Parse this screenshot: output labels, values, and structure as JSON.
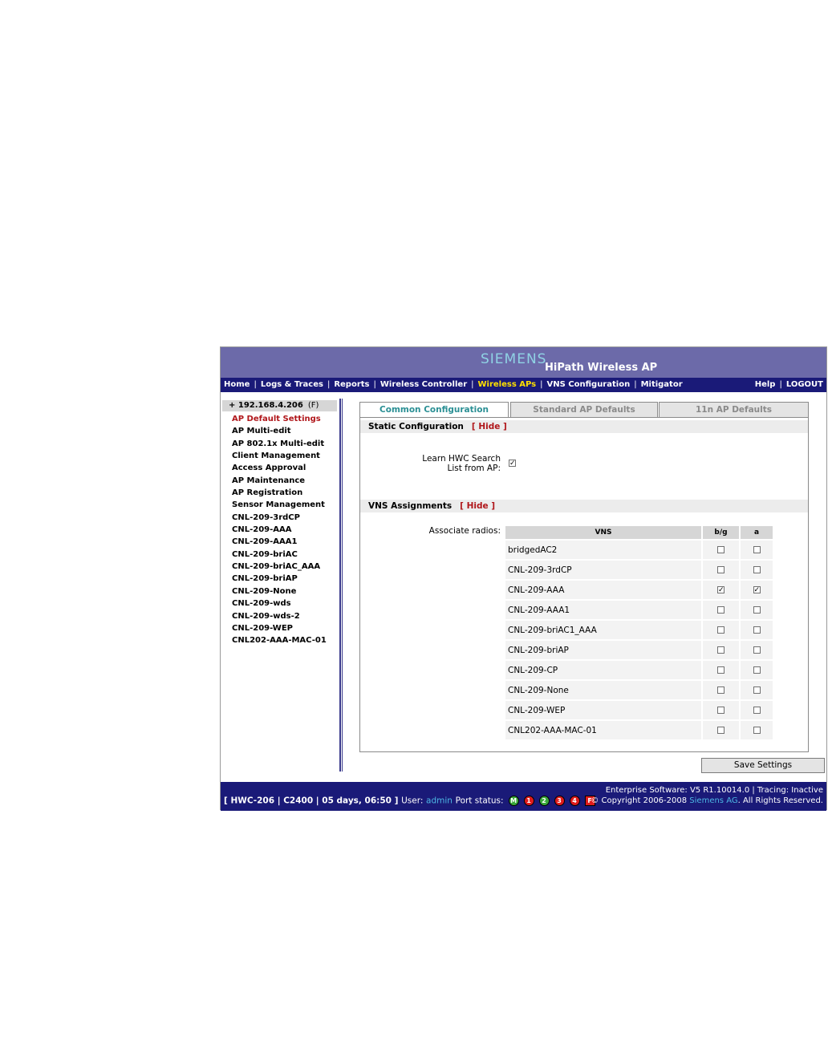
{
  "header": {
    "brand": "SIEMENS",
    "product": "HiPath Wireless AP"
  },
  "nav": {
    "items": [
      "Home",
      "Logs & Traces",
      "Reports",
      "Wireless Controller",
      "Wireless APs",
      "VNS Configuration",
      "Mitigator"
    ],
    "active": "Wireless APs",
    "help": "Help",
    "logout": "LOGOUT"
  },
  "sidebar": {
    "root": "+ 192.168.4.206",
    "root_flag": "(F)",
    "items": [
      "AP Default Settings",
      "AP Multi-edit",
      "AP 802.1x Multi-edit",
      "Client Management",
      "Access Approval",
      "AP Maintenance",
      "AP Registration",
      "Sensor Management",
      "CNL-209-3rdCP",
      "CNL-209-AAA",
      "CNL-209-AAA1",
      "CNL-209-briAC",
      "CNL-209-briAC_AAA",
      "CNL-209-briAP",
      "CNL-209-None",
      "CNL-209-wds",
      "CNL-209-wds-2",
      "CNL-209-WEP",
      "CNL202-AAA-MAC-01"
    ]
  },
  "tabs": [
    "Common Configuration",
    "Standard AP Defaults",
    "11n AP Defaults"
  ],
  "static_config": {
    "title": "Static Configuration",
    "hide": "[ Hide ]",
    "learn_label_1": "Learn HWC Search",
    "learn_label_2": "List from AP:",
    "learn_mark": "✓"
  },
  "vns_assign": {
    "title": "VNS Assignments",
    "hide": "[ Hide ]",
    "assoc_label": "Associate radios:",
    "headers": [
      "VNS",
      "b/g",
      "a"
    ],
    "rows": [
      {
        "name": "bridgedAC2",
        "bg": "",
        "a": ""
      },
      {
        "name": "CNL-209-3rdCP",
        "bg": "",
        "a": ""
      },
      {
        "name": "CNL-209-AAA",
        "bg": "✓",
        "a": "✓"
      },
      {
        "name": "CNL-209-AAA1",
        "bg": "",
        "a": ""
      },
      {
        "name": "CNL-209-briAC1_AAA",
        "bg": "",
        "a": ""
      },
      {
        "name": "CNL-209-briAP",
        "bg": "",
        "a": ""
      },
      {
        "name": "CNL-209-CP",
        "bg": "",
        "a": ""
      },
      {
        "name": "CNL-209-None",
        "bg": "",
        "a": ""
      },
      {
        "name": "CNL-209-WEP",
        "bg": "",
        "a": ""
      },
      {
        "name": "CNL202-AAA-MAC-01",
        "bg": "",
        "a": ""
      }
    ]
  },
  "save_label": "Save Settings",
  "footer": {
    "status": "[ HWC-206 | C2400 | 05 days, 06:50 ]",
    "user_label": "User:",
    "user": "admin",
    "port_label": "Port status:",
    "ports": [
      "M",
      "1",
      "2",
      "3",
      "4",
      "F"
    ],
    "software": "Enterprise Software: V5 R1.10014.0 | Tracing: Inactive",
    "copyright_pre": "© Copyright  2006-2008",
    "company": "Siemens AG",
    "copyright_post": ". All Rights Reserved."
  },
  "colors": {
    "banner": "#6c6aa9",
    "nav": "#1a1a78",
    "active_nav": "#ffe000",
    "selected": "#b0161a",
    "tab_active": "#2a8f94"
  }
}
